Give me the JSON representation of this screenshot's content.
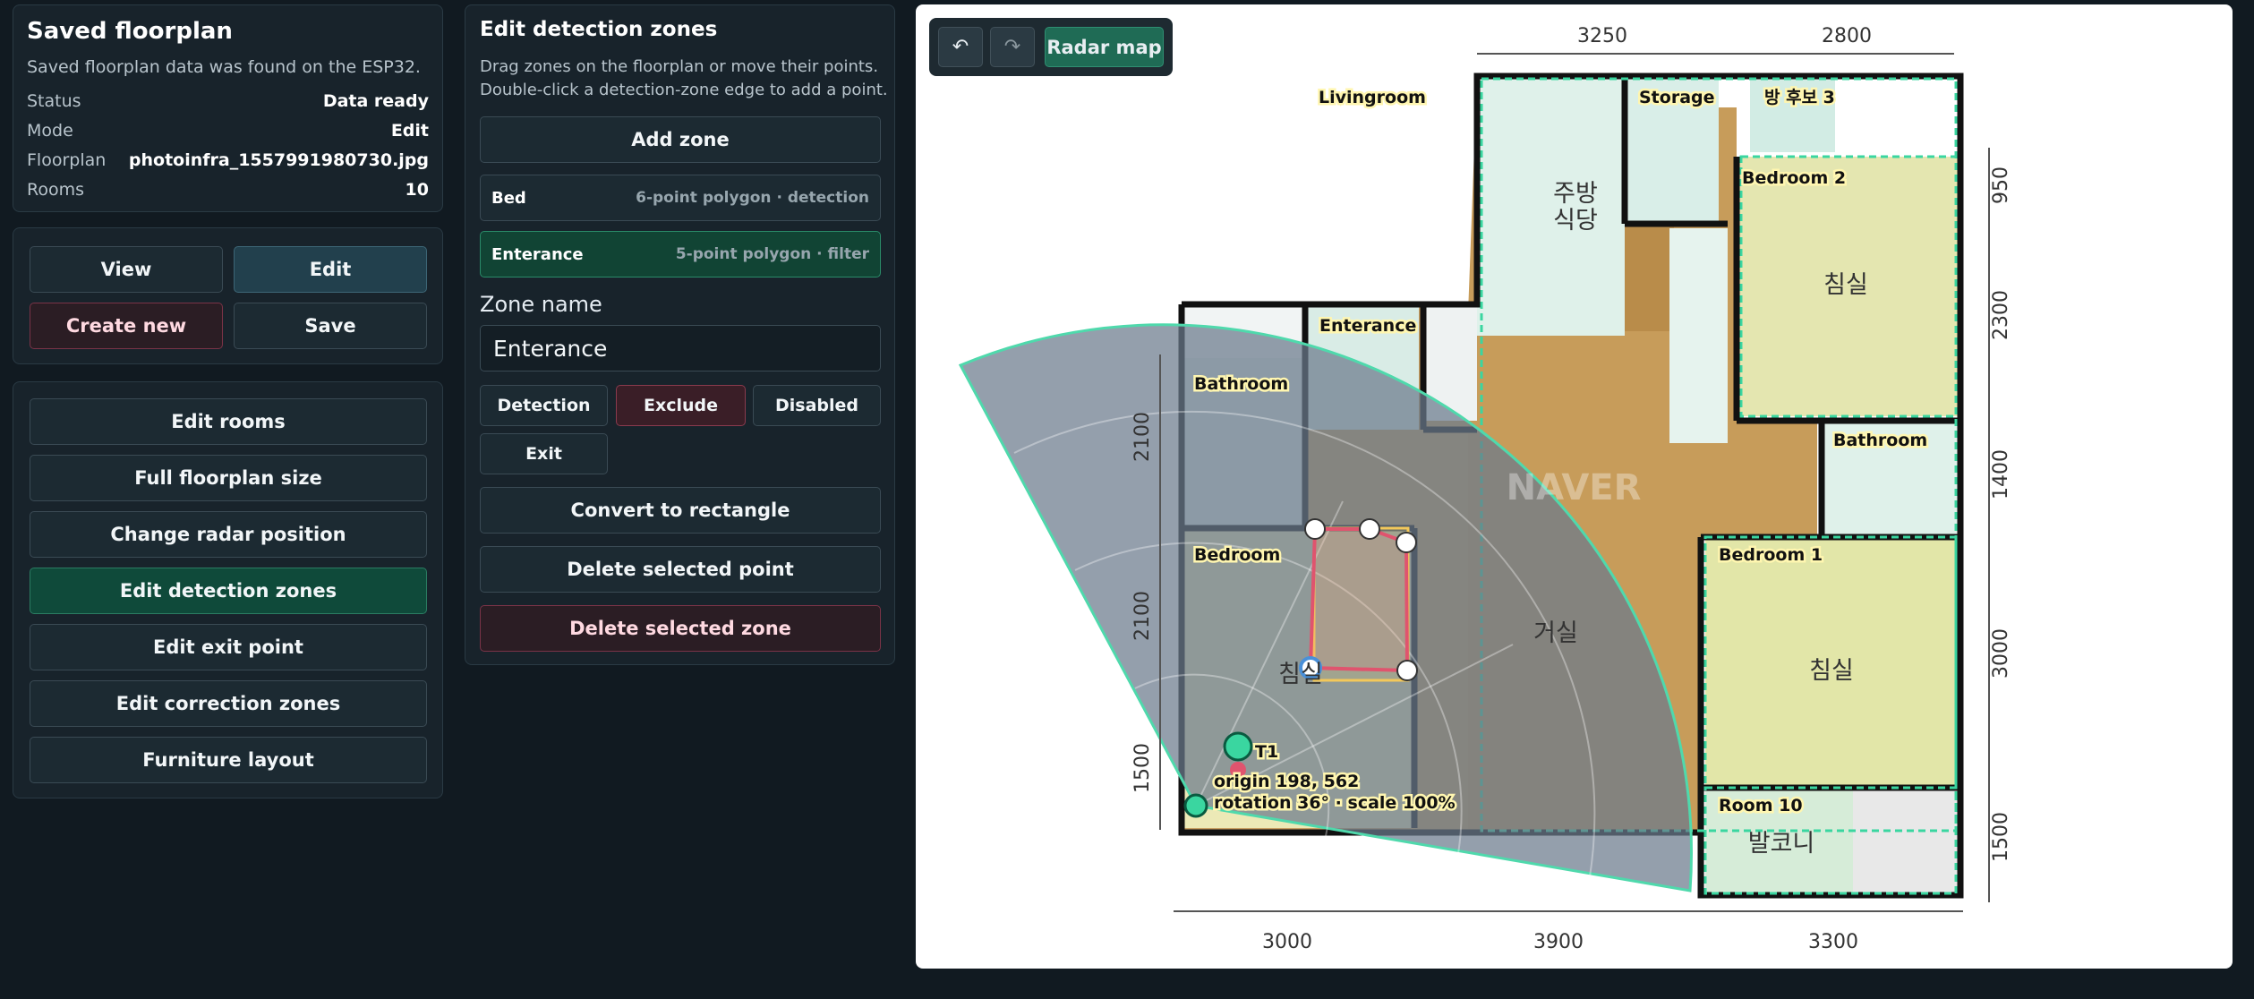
{
  "saved": {
    "title": "Saved floorplan",
    "subtitle": "Saved floorplan data was found on the ESP32.",
    "rows": [
      {
        "k": "Status",
        "v": "Data ready"
      },
      {
        "k": "Mode",
        "v": "Edit"
      },
      {
        "k": "Floorplan",
        "v": "photoinfra_1557991980730.jpg"
      },
      {
        "k": "Rooms",
        "v": "10"
      }
    ]
  },
  "actions": {
    "view": "View",
    "edit": "Edit",
    "create": "Create new",
    "save": "Save"
  },
  "menu": [
    "Edit rooms",
    "Full floorplan size",
    "Change radar position",
    "Edit detection zones",
    "Edit exit point",
    "Edit correction zones",
    "Furniture layout"
  ],
  "zones": {
    "title": "Edit detection zones",
    "desc1": "Drag zones on the floorplan or move their points.",
    "desc2": "Double-click a detection-zone edge to add a point.",
    "add": "Add zone",
    "list": [
      {
        "name": "Bed",
        "detail": "6-point polygon · detection"
      },
      {
        "name": "Enterance",
        "detail": "5-point polygon · filter"
      }
    ],
    "name_label": "Zone name",
    "name_value": "Enterance",
    "types": [
      "Detection",
      "Exclude",
      "Disabled",
      "Exit"
    ],
    "convert": "Convert to rectangle",
    "delete_point": "Delete selected point",
    "delete_zone": "Delete selected zone"
  },
  "toolbar": {
    "undo": "↶",
    "redo": "↷",
    "radar": "Radar map"
  },
  "map": {
    "rooms": [
      "Livingroom",
      "Storage",
      "방 후보 3",
      "Bedroom 2",
      "Enterance",
      "Bathroom",
      "Bathroom",
      "Bedroom",
      "Bedroom 1",
      "Room 10"
    ],
    "korean": [
      "주방",
      "식당",
      "침실",
      "침실",
      "침실",
      "거실",
      "발코니"
    ],
    "watermark": "NAVER",
    "dims_top": [
      "3250",
      "2800"
    ],
    "dims_bottom": [
      "3000",
      "3900",
      "3300"
    ],
    "dims_right": [
      "950",
      "2300",
      "1400",
      "3000",
      "1500"
    ],
    "dims_left": [
      "2100",
      "2100",
      "1500"
    ],
    "radar_label": "T1",
    "origin": "origin 198, 562",
    "rotation": "rotation 36° · scale 100%",
    "colors": {
      "zone_edge": "#3ad6a0",
      "selected": "#e0546e",
      "floor": "#c9a062",
      "fov": "#6b7a8c"
    }
  }
}
